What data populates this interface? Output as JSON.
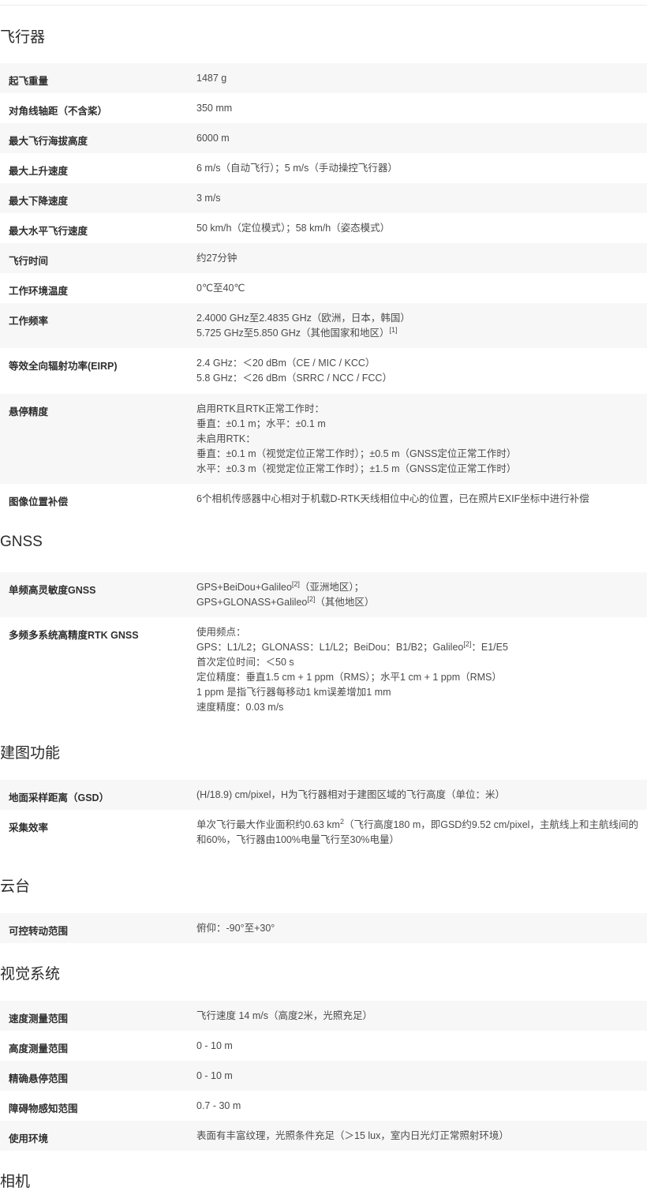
{
  "sections": [
    {
      "id": "aircraft",
      "title": "飞行器",
      "rows": [
        {
          "label": "起飞重量",
          "lines": [
            [
              "1487 g"
            ]
          ]
        },
        {
          "label": "对角线轴距（不含桨）",
          "lines": [
            [
              "350 mm"
            ]
          ]
        },
        {
          "label": "最大飞行海拔高度",
          "lines": [
            [
              "6000 m"
            ]
          ]
        },
        {
          "label": "最大上升速度",
          "lines": [
            [
              "6 m/s（自动飞行）；5 m/s（手动操控飞行器）"
            ]
          ]
        },
        {
          "label": "最大下降速度",
          "lines": [
            [
              "3 m/s"
            ]
          ]
        },
        {
          "label": "最大水平飞行速度",
          "lines": [
            [
              "50 km/h（定位模式）；58 km/h（姿态模式）"
            ]
          ]
        },
        {
          "label": "飞行时间",
          "lines": [
            [
              "约27分钟"
            ]
          ]
        },
        {
          "label": "工作环境温度",
          "lines": [
            [
              "0℃至40℃"
            ]
          ]
        },
        {
          "label": "工作频率",
          "lines": [
            [
              "2.4000 GHz至2.4835 GHz（欧洲，日本，韩国）"
            ],
            [
              "5.725 GHz至5.850 GHz（其他国家和地区）",
              "[1]"
            ]
          ]
        },
        {
          "label": "等效全向辐射功率(EIRP)",
          "lines": [
            [
              "2.4 GHz：＜20 dBm（CE / MIC / KCC）"
            ],
            [
              "5.8 GHz：＜26 dBm（SRRC / NCC / FCC）"
            ]
          ]
        },
        {
          "label": "悬停精度",
          "lines": [
            [
              "启用RTK且RTK正常工作时："
            ],
            [
              "垂直：±0.1 m；水平：±0.1 m"
            ],
            [
              "未启用RTK："
            ],
            [
              "垂直：±0.1 m（视觉定位正常工作时）；±0.5 m（GNSS定位正常工作时）"
            ],
            [
              "水平：±0.3 m（视觉定位正常工作时）；±1.5 m（GNSS定位正常工作时）"
            ]
          ]
        },
        {
          "label": "图像位置补偿",
          "lines": [
            [
              "6个相机传感器中心相对于机载D-RTK天线相位中心的位置，已在照片EXIF坐标中进行补偿"
            ]
          ]
        }
      ]
    },
    {
      "id": "gnss",
      "title": "GNSS",
      "rows": [
        {
          "label": "单频高灵敏度GNSS",
          "lines": [
            [
              "GPS+BeiDou+Galileo",
              "[2]",
              "（亚洲地区）；"
            ],
            [
              "GPS+GLONASS+Galileo",
              "[2]",
              "（其他地区）"
            ]
          ]
        },
        {
          "label": "多频多系统高精度RTK GNSS",
          "lines": [
            [
              "使用频点："
            ],
            [
              "GPS：L1/L2；GLONASS：L1/L2；BeiDou：B1/B2；Galileo",
              "[2]",
              "：E1/E5"
            ],
            [
              "首次定位时间：＜50 s"
            ],
            [
              "定位精度：垂直1.5 cm + 1 ppm（RMS）；水平1 cm + 1 ppm（RMS）"
            ],
            [
              "1 ppm 是指飞行器每移动1 km误差增加1 mm"
            ],
            [
              "速度精度：0.03 m/s"
            ]
          ]
        }
      ]
    },
    {
      "id": "mapping",
      "title": "建图功能",
      "rows": [
        {
          "label": "地面采样距离（GSD）",
          "lines": [
            [
              "(H/18.9) cm/pixel，H为飞行器相对于建图区域的飞行高度（单位：米）"
            ]
          ]
        },
        {
          "label": "采集效率",
          "lines": [
            [
              "单次飞行最大作业面积约0.63 km",
              "2",
              "（飞行高度180 m，即GSD约9.52 cm/pixel，主航线上和主航线间的"
            ],
            [
              "和60%，飞行器由100%电量飞行至30%电量）"
            ]
          ]
        }
      ]
    },
    {
      "id": "gimbal",
      "title": "云台",
      "rows": [
        {
          "label": "可控转动范围",
          "lines": [
            [
              "俯仰：-90°至+30°"
            ]
          ]
        }
      ]
    },
    {
      "id": "vision",
      "title": "视觉系统",
      "rows": [
        {
          "label": "速度测量范围",
          "lines": [
            [
              "飞行速度 14 m/s（高度2米，光照充足）"
            ]
          ]
        },
        {
          "label": "高度测量范围",
          "lines": [
            [
              "0 - 10 m"
            ]
          ]
        },
        {
          "label": "精确悬停范围",
          "lines": [
            [
              "0 - 10 m"
            ]
          ]
        },
        {
          "label": "障碍物感知范围",
          "lines": [
            [
              "0.7 - 30 m"
            ]
          ]
        },
        {
          "label": "使用环境",
          "lines": [
            [
              "表面有丰富纹理，光照条件充足（＞15 lux，室内日光灯正常照射环境）"
            ]
          ]
        }
      ]
    },
    {
      "id": "camera",
      "title": "相机",
      "rows": []
    }
  ]
}
